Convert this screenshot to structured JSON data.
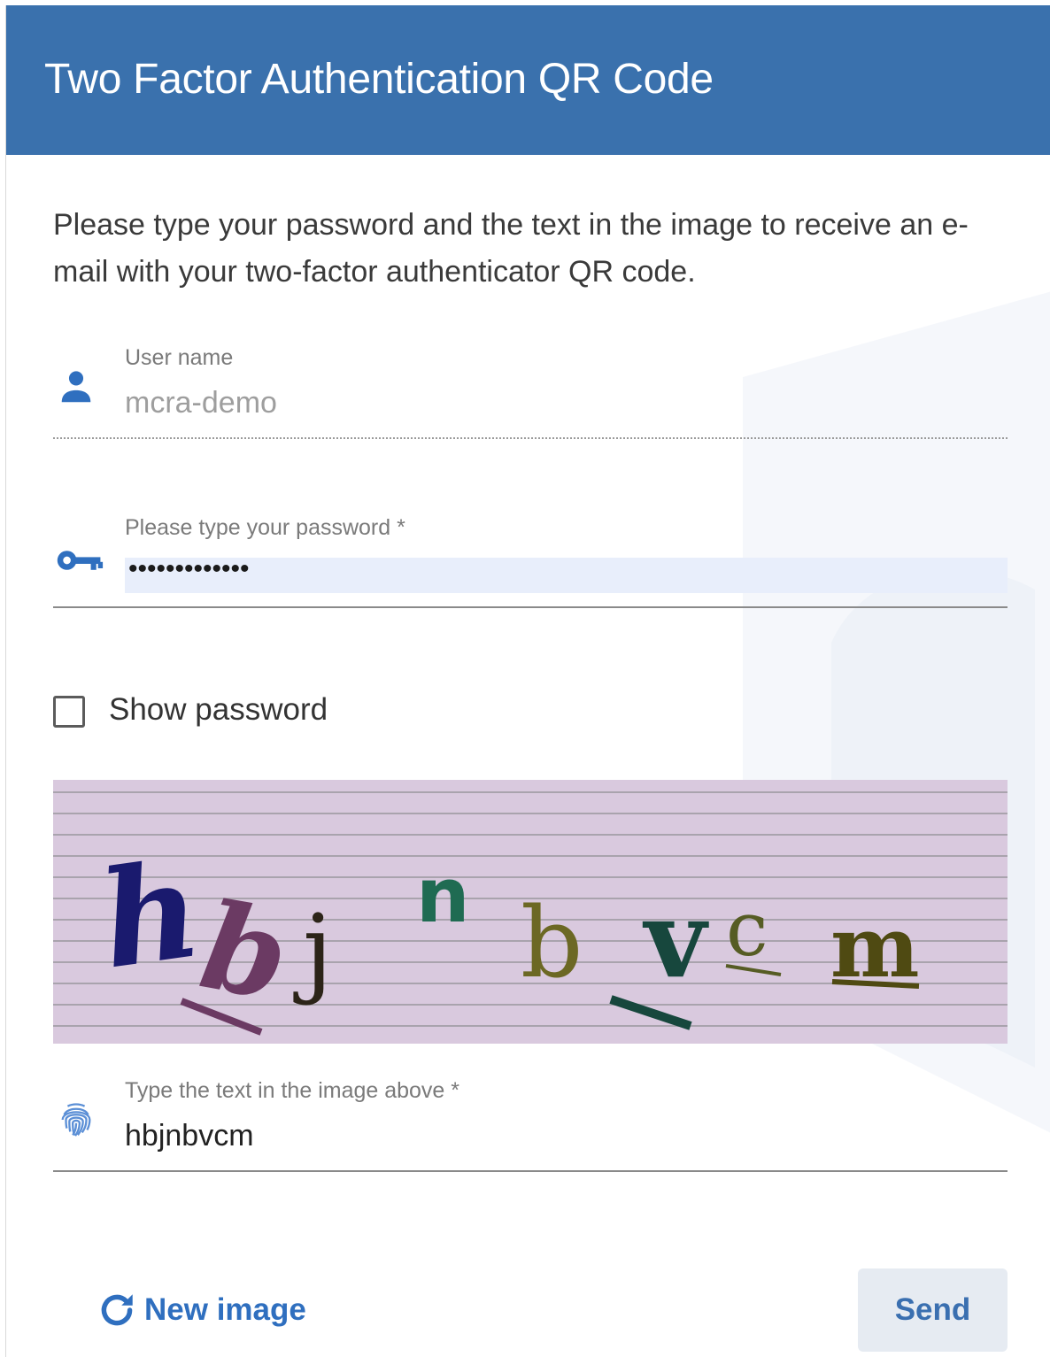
{
  "header": {
    "title": "Two Factor Authentication QR Code"
  },
  "intro": {
    "text": "Please type your password and the text in the image to receive an e-mail with your two-factor authenticator QR code."
  },
  "username": {
    "label": "User name",
    "value": "mcra-demo",
    "icon": "person-icon"
  },
  "password": {
    "label": "Please type your password *",
    "masked_value": "•••••••••••••",
    "icon": "key-icon"
  },
  "show_password": {
    "label": "Show password",
    "checked": false
  },
  "captcha": {
    "alt": "captcha image",
    "characters": [
      "h",
      "b",
      "j",
      "n",
      "b",
      "v",
      "c",
      "m"
    ]
  },
  "captcha_input": {
    "label": "Type the text in the image above *",
    "value": "hbjnbvcm",
    "icon": "fingerprint-icon"
  },
  "footer": {
    "refresh_label": "New image",
    "refresh_icon": "refresh-icon",
    "send_label": "Send"
  },
  "colors": {
    "header_bg": "#3a71ad",
    "accent": "#2f6fbf",
    "captcha_bg": "#d9c9de"
  }
}
